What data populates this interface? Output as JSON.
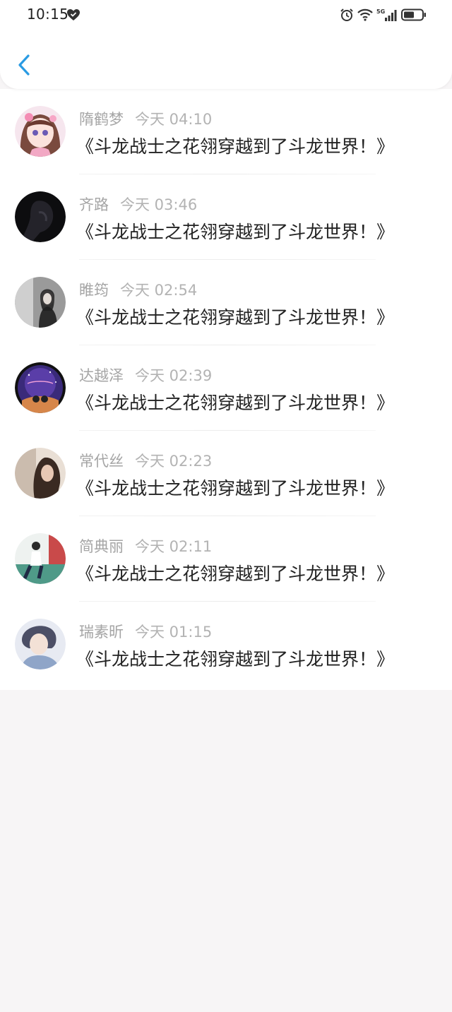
{
  "status_bar": {
    "time": "10:15",
    "icons": [
      "heart-icon",
      "alarm-icon",
      "wifi-icon",
      "signal-5g-icon",
      "battery-icon"
    ],
    "network": "5G"
  },
  "header": {
    "back_icon": "chevron-left-icon",
    "accent_color": "#2a9be3"
  },
  "messages": [
    {
      "name": "隋鹤梦",
      "time": "今天 04:10",
      "text": "《斗龙战士之花翎穿越到了斗龙世界！》"
    },
    {
      "name": "齐路",
      "time": "今天 03:46",
      "text": "《斗龙战士之花翎穿越到了斗龙世界！》"
    },
    {
      "name": "睢筠",
      "time": "今天 02:54",
      "text": "《斗龙战士之花翎穿越到了斗龙世界！》"
    },
    {
      "name": "达越泽",
      "time": "今天 02:39",
      "text": "《斗龙战士之花翎穿越到了斗龙世界！》"
    },
    {
      "name": "常代丝",
      "time": "今天 02:23",
      "text": "《斗龙战士之花翎穿越到了斗龙世界！》"
    },
    {
      "name": "简典丽",
      "time": "今天 02:11",
      "text": "《斗龙战士之花翎穿越到了斗龙世界！》"
    },
    {
      "name": "瑞素昕",
      "time": "今天 01:15",
      "text": "《斗龙战士之花翎穿越到了斗龙世界！》"
    }
  ]
}
